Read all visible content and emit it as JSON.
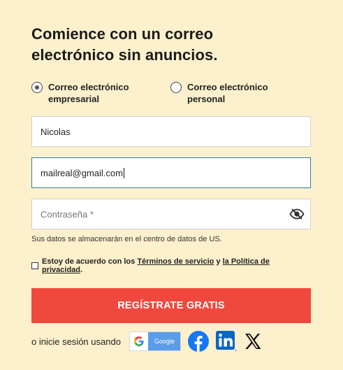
{
  "heading": {
    "line1": "Comience con un correo",
    "line2": "electrónico sin anuncios."
  },
  "account_type": {
    "options": [
      {
        "line1": "Correo electrónico",
        "line2": "empresarial",
        "selected": true
      },
      {
        "line1": "Correo electrónico",
        "line2": "personal",
        "selected": false
      }
    ]
  },
  "form": {
    "name_value": "Nicolas",
    "email_value": "mailreal@gmail.com",
    "password_placeholder": "Contraseña *",
    "data_note": "Sus datos se almacenarán en el centro de datos de US."
  },
  "consent": {
    "prefix": "Estoy de acuerdo con los ",
    "terms_link": "Términos de servicio",
    "middle": " y ",
    "privacy_link": "la Política de privacidad",
    "suffix": ".",
    "checked": false
  },
  "signup_button": "REGÍSTRATE GRATIS",
  "social_login": {
    "label": "o inicie sesión usando",
    "google_label": "Google",
    "icons": [
      "google-icon",
      "facebook-icon",
      "linkedin-icon",
      "x-icon"
    ]
  },
  "colors": {
    "background": "#fdf0cc",
    "cta": "#f0483e",
    "focus_border": "#2b7fa8",
    "google": "#5b9de8",
    "facebook": "#1877f2",
    "linkedin": "#0a66c2"
  }
}
